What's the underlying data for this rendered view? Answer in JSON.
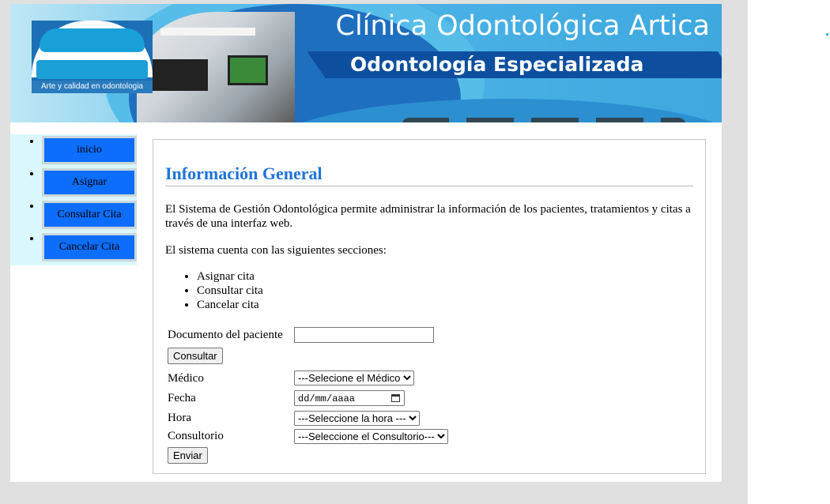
{
  "header": {
    "title": "Clínica Odontológica Artica",
    "subtitle": "Odontología Especializada",
    "logo_tagline": "Arte y calidad en odontologia"
  },
  "sidebar": {
    "items": [
      {
        "label": "inicio"
      },
      {
        "label": "Asignar"
      },
      {
        "label": "Consultar Cita"
      },
      {
        "label": "Cancelar Cita"
      }
    ]
  },
  "main": {
    "title": "Información General",
    "intro": "El Sistema de Gestión Odontológica permite administrar la información de los pacientes, tratamientos y citas a través de una interfaz web.",
    "sections_intro": "El sistema cuenta con las siguientes secciones:",
    "sections": [
      "Asignar cita",
      "Consultar cita",
      "Cancelar cita"
    ]
  },
  "form": {
    "document_label": "Documento del paciente",
    "document_value": "",
    "consult_button": "Consultar",
    "doctor_label": "Médico",
    "doctor_selected": "---Selecione el Médico",
    "date_label": "Fecha",
    "date_placeholder": "dd/mm/aaaa",
    "time_label": "Hora",
    "time_selected": "---Seleccione la hora ---",
    "office_label": "Consultorio",
    "office_selected": "---Seleccione el Consultorio---",
    "submit_button": "Enviar"
  },
  "colors": {
    "accent": "#1f74d6",
    "nav_button": "#0d6efd",
    "sidebar_bg": "#d9f7fc",
    "banner_blue": "#3ea8df"
  }
}
